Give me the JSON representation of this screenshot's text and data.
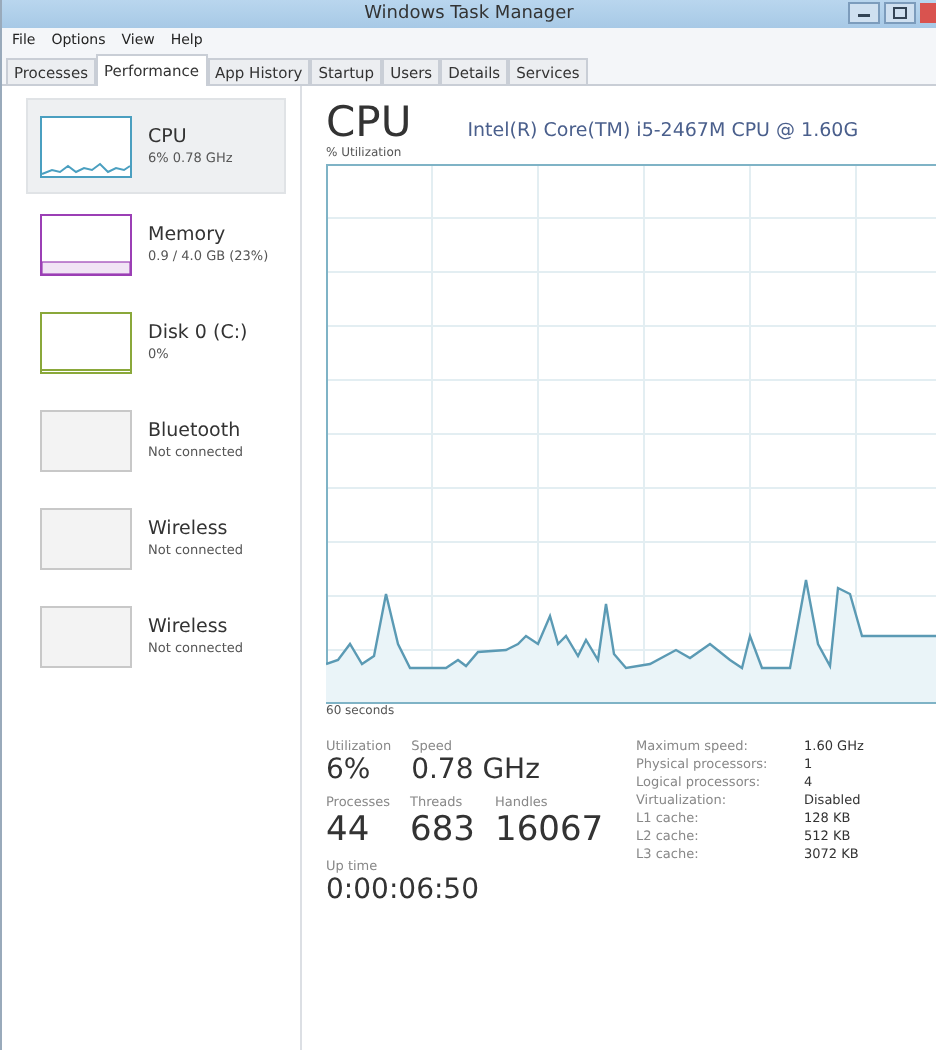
{
  "window": {
    "title": "Windows Task Manager"
  },
  "menu": [
    "File",
    "Options",
    "View",
    "Help"
  ],
  "tabs": [
    {
      "label": "Processes",
      "selected": false
    },
    {
      "label": "Performance",
      "selected": true
    },
    {
      "label": "App History",
      "selected": false
    },
    {
      "label": "Startup",
      "selected": false
    },
    {
      "label": "Users",
      "selected": false
    },
    {
      "label": "Details",
      "selected": false
    },
    {
      "label": "Services",
      "selected": false
    }
  ],
  "sidebar": {
    "items": [
      {
        "kind": "cpu",
        "name": "CPU",
        "detail": "6% 0.78 GHz",
        "selected": true,
        "color": "#4a9fc0"
      },
      {
        "kind": "memory",
        "name": "Memory",
        "detail": "0.9 / 4.0 GB (23%)",
        "selected": false,
        "color": "#9b3fb5"
      },
      {
        "kind": "disk",
        "name": "Disk 0 (C:)",
        "detail": "0%",
        "selected": false,
        "color": "#8aa83a"
      },
      {
        "kind": "network",
        "name": "Bluetooth",
        "detail": "Not connected",
        "selected": false,
        "color": "#c8c8c8"
      },
      {
        "kind": "network",
        "name": "Wireless",
        "detail": "Not connected",
        "selected": false,
        "color": "#c8c8c8"
      },
      {
        "kind": "network",
        "name": "Wireless",
        "detail": "Not connected",
        "selected": false,
        "color": "#c8c8c8"
      }
    ]
  },
  "detail": {
    "title": "CPU",
    "model": "Intel(R) Core(TM) i5-2467M CPU @ 1.60G",
    "graph_label": "% Utilization",
    "graph_time": "60 seconds",
    "stats": [
      [
        {
          "label": "Utilization",
          "value": "6%"
        },
        {
          "label": "Speed",
          "value": "0.78 GHz"
        }
      ],
      [
        {
          "label": "Processes",
          "value": "44"
        },
        {
          "label": "Threads",
          "value": "683"
        },
        {
          "label": "Handles",
          "value": "16067"
        }
      ],
      [
        {
          "label": "Up time",
          "value": "0:00:06:50"
        }
      ]
    ],
    "specs": [
      {
        "label": "Maximum speed:",
        "value": "1.60 GHz"
      },
      {
        "label": "Physical processors:",
        "value": "1"
      },
      {
        "label": "Logical processors:",
        "value": "4"
      },
      {
        "label": "Virtualization:",
        "value": "Disabled"
      },
      {
        "label": "L1 cache:",
        "value": "128 KB"
      },
      {
        "label": "L2 cache:",
        "value": "512 KB"
      },
      {
        "label": "L3 cache:",
        "value": "3072 KB"
      }
    ]
  }
}
